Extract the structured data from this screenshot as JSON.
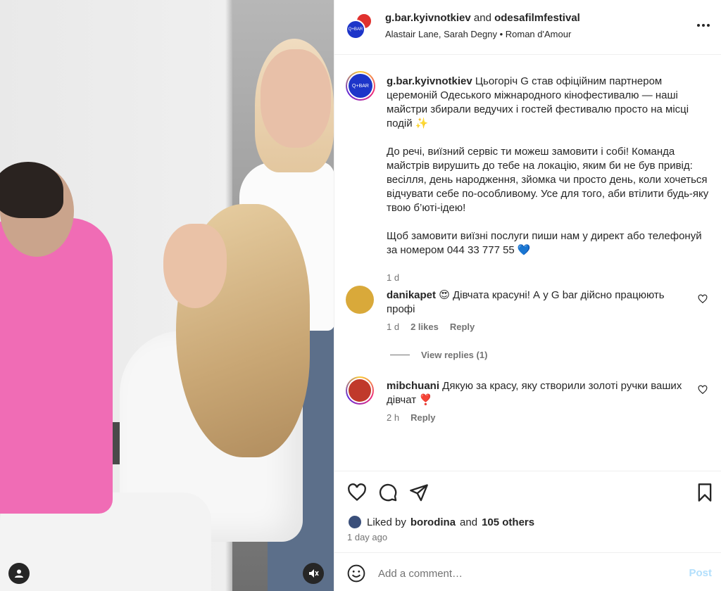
{
  "header": {
    "account_1": "g.bar.kyivnotkiev",
    "connector": "and",
    "account_2": "odesafilmfestival",
    "subtitle": "Alastair Lane, Sarah Degny • Roman d'Amour",
    "avatar_text": "Q+BAR"
  },
  "caption": {
    "username": "g.bar.kyivnotkiev",
    "text": " Цьогоріч G став офіційним партнером церемоній Одеського міжнародного кінофестивалю — наші майстри збирали ведучих і гостей фестивалю просто на місці подій ✨\n\nДо речі, виїзний сервіс ти можеш замовити і собі! Команда майстрів вирушить до тебе на локацію, яким би не був привід: весілля, день народження, зйомка чи просто день, коли хочеться відчувати себе по-особливому. Усе для того, аби втілити будь-яку твою б’юті-ідею!\n\nЩоб замовити виїзні послуги пиши нам у директ або телефонуй за номером 044 33 777 55 💙",
    "time": "1 d",
    "avatar_text": "Q+BAR"
  },
  "comments": [
    {
      "username": "danikapet",
      "text": " 😍 Дівчата красуні! А у G bar дійсно працюють профі",
      "time": "1 d",
      "likes": "2 likes",
      "reply": "Reply",
      "avatar_color": "#d9a93a"
    },
    {
      "username": "mibchuani",
      "text": " Дякую за красу, яку створили золоті ручки ваших дівчат ❣️",
      "time": "2 h",
      "reply": "Reply",
      "avatar_color": "#c0392b"
    }
  ],
  "view_replies": "View replies (1)",
  "likes": {
    "prefix": "Liked by",
    "user": "borodina",
    "connector": "and",
    "others": "105 others"
  },
  "date": "1 day ago",
  "comment_box": {
    "placeholder": "Add a comment…",
    "post_label": "Post"
  },
  "icons": {
    "like": "heart-icon",
    "comment": "comment-icon",
    "share": "share-icon",
    "save": "bookmark-icon",
    "more": "more-icon",
    "emoji": "emoji-icon",
    "user_tags": "user-icon",
    "mute": "muted-icon"
  },
  "colors": {
    "text": "#262626",
    "secondary": "#737373",
    "post_disabled": "#b2dffc",
    "brand_blue": "#1d35c9"
  }
}
